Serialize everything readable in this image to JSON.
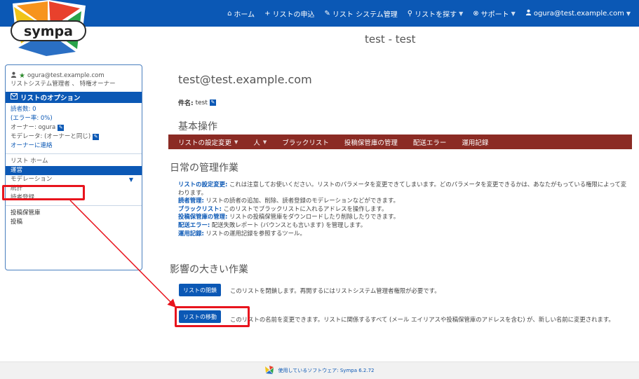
{
  "nav": {
    "items": [
      {
        "icon": "home-icon",
        "glyph": "⌂",
        "label": "ホーム",
        "caret": false
      },
      {
        "icon": "plus-icon",
        "glyph": "+",
        "label": "リストの申込",
        "caret": false
      },
      {
        "icon": "wrench-icon",
        "glyph": "✎",
        "label": "リスト システム管理",
        "caret": false
      },
      {
        "icon": "search-icon",
        "glyph": "⚲",
        "label": "リストを探す",
        "caret": true
      },
      {
        "icon": "support-icon",
        "glyph": "⊗",
        "label": "サポート",
        "caret": true
      },
      {
        "icon": "user-icon",
        "glyph": "👤",
        "label": "ogura@test.example.com",
        "caret": true
      }
    ]
  },
  "logo": {
    "text": "sympa"
  },
  "page_title": "test - test",
  "sidebar": {
    "user_email": "ogura@test.example.com",
    "user_role": "リストシステム管理者 、 特権オーナー",
    "options_heading": "リストのオプション",
    "subscribers": "読者数: 0",
    "error_rate": "(エラー率: 0%)",
    "owner": "オーナー: ogura",
    "moderator": "モデレータ: (オーナーと同じ)",
    "contact_owner": "オーナーに連絡",
    "list_home": "リスト ホーム",
    "admin": "運営",
    "moderation": "モデレーション",
    "stats": "統計",
    "subscribe": "読者登録",
    "archives": "投稿保管庫",
    "post": "投稿"
  },
  "main": {
    "list_address": "test@test.example.com",
    "subject_label": "件名:",
    "subject_value": "test",
    "basic_ops_title": "基本操作",
    "ops_menu": [
      {
        "label": "リストの設定変更",
        "caret": true
      },
      {
        "label": "人",
        "caret": true
      },
      {
        "label": "ブラックリスト",
        "caret": false
      },
      {
        "label": "投稿保管庫の管理",
        "caret": false
      },
      {
        "label": "配送エラー",
        "caret": false
      },
      {
        "label": "運用記録",
        "caret": false
      }
    ],
    "daily_title": "日常の管理作業",
    "daily_items": [
      {
        "key": "リストの設定変更:",
        "text": "これは注意してお使いください。リストのパラメータを変更できてしまいます。どのパラメータを変更できるかは、あなたがもっている権限によって変わります。"
      },
      {
        "key": "読者管理:",
        "text": "リストの読者の追加、削除、読者登録のモデレーションなどができます。"
      },
      {
        "key": "ブラックリスト:",
        "text": "このリストでブラックリストに入れるアドレスを操作します。"
      },
      {
        "key": "投稿保管庫の管理:",
        "text": "リストの投稿保管庫をダウンロードしたり削除したりできます。"
      },
      {
        "key": "配送エラー:",
        "text": "配送失敗レポート (バウンスとも言います) を管理します。"
      },
      {
        "key": "運用記録:",
        "text": "リストの運用記録を参照するツール。"
      }
    ],
    "impact_title": "影響の大きい作業",
    "close_button": "リストの閉鎖",
    "close_text": "このリストを閉鎖します。再開するにはリストシステム管理者権限が必要です。",
    "move_button": "リストの移動",
    "move_text": "このリストの名前を変更できます。リストに関係するすべて (メール エイリアスや投稿保管庫のアドレスを含む) が、新しい名前に変更されます。"
  },
  "footer": {
    "text": "使用しているソフトウェア: Sympa 6.2.72"
  },
  "colors": {
    "brand": "#0b58b5",
    "ops_bar": "#8b2b24",
    "highlight": "#e8141d"
  }
}
